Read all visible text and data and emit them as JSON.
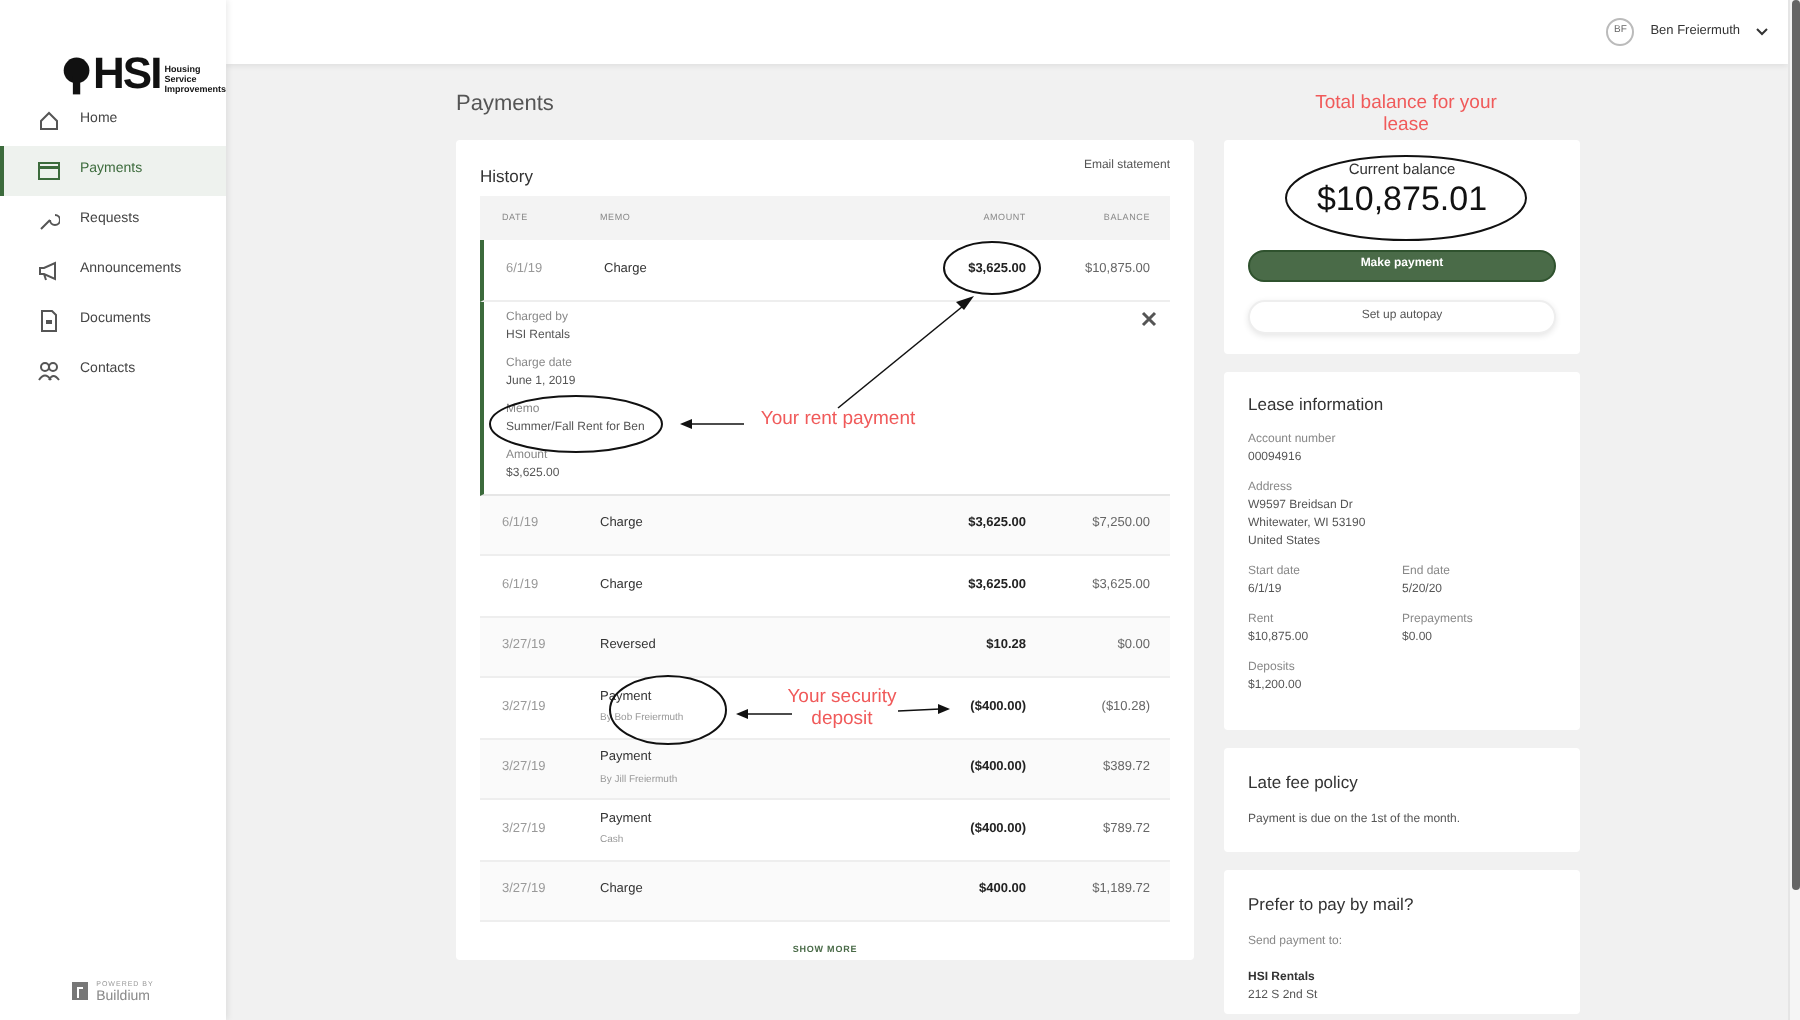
{
  "logo": {
    "text": "HSI",
    "tagline": [
      "Housing",
      "Service",
      "Improvements"
    ]
  },
  "sidebar": {
    "items": [
      {
        "label": "Home",
        "selected": false
      },
      {
        "label": "Payments",
        "selected": true
      },
      {
        "label": "Requests",
        "selected": false
      },
      {
        "label": "Announcements",
        "selected": false
      },
      {
        "label": "Documents",
        "selected": false
      },
      {
        "label": "Contacts",
        "selected": false
      }
    ],
    "footer": {
      "caption": "POWERED BY",
      "brand": "Buildium"
    }
  },
  "header": {
    "user_initials": "BF",
    "user_name": "Ben Freiermuth"
  },
  "page_title": "Payments",
  "history": {
    "title": "History",
    "email_link": "Email statement",
    "columns": [
      "DATE",
      "MEMO",
      "AMOUNT",
      "BALANCE"
    ],
    "rows": [
      {
        "date": "6/1/19",
        "memo": "Charge",
        "amount": "$3,625.00",
        "balance": "$10,875.00",
        "expanded": true,
        "details": [
          {
            "label": "Charged by",
            "value": "HSI Rentals"
          },
          {
            "label": "Charge date",
            "value": "June 1, 2019"
          },
          {
            "label": "Memo",
            "value": "Summer/Fall Rent for Ben"
          },
          {
            "label": "Amount",
            "value": "$3,625.00"
          }
        ]
      },
      {
        "date": "6/1/19",
        "memo": "Charge",
        "amount": "$3,625.00",
        "balance": "$7,250.00",
        "expanded": false
      },
      {
        "date": "6/1/19",
        "memo": "Charge",
        "amount": "$3,625.00",
        "balance": "$3,625.00",
        "expanded": false
      },
      {
        "date": "3/27/19",
        "memo": "Reversed",
        "amount": "$10.28",
        "balance": "$0.00",
        "expanded": false
      },
      {
        "date": "3/27/19",
        "memo": "Payment",
        "sub": "By Bob Freiermuth",
        "amount": "($400.00)",
        "balance": "($10.28)",
        "expanded": false
      },
      {
        "date": "3/27/19",
        "memo": "Payment",
        "sub": "By Jill Freiermuth",
        "amount": "($400.00)",
        "balance": "$389.72",
        "expanded": false
      },
      {
        "date": "3/27/19",
        "memo": "Payment",
        "sub": "Cash",
        "amount": "($400.00)",
        "balance": "$789.72",
        "expanded": false
      },
      {
        "date": "3/27/19",
        "memo": "Charge",
        "amount": "$400.00",
        "balance": "$1,189.72",
        "expanded": false
      }
    ],
    "show_more": "SHOW MORE"
  },
  "balance": {
    "label": "Current balance",
    "amount": "$10,875.01",
    "primary_button": "Make payment",
    "secondary_button": "Set up autopay"
  },
  "lease": {
    "title": "Lease information",
    "fields": [
      {
        "kind": "full",
        "label": "Account number",
        "lines": [
          "00094916"
        ]
      },
      {
        "kind": "full",
        "label": "Address",
        "lines": [
          "W9597 Breidsan Dr",
          "Whitewater, WI 53190",
          "United States"
        ]
      },
      {
        "kind": "half",
        "label": "Start date",
        "lines": [
          "6/1/19"
        ]
      },
      {
        "kind": "half",
        "label": "End date",
        "lines": [
          "5/20/20"
        ]
      },
      {
        "kind": "half",
        "label": "Rent",
        "lines": [
          "$10,875.00"
        ]
      },
      {
        "kind": "half",
        "label": "Prepayments",
        "lines": [
          "$0.00"
        ]
      },
      {
        "kind": "full",
        "label": "Deposits",
        "lines": [
          "$1,200.00"
        ]
      }
    ]
  },
  "late_fee": {
    "title": "Late fee policy",
    "text": "Payment is due on the 1st of the month."
  },
  "mail": {
    "title": "Prefer to pay by mail?",
    "text": "Send payment to:",
    "name": "HSI Rentals",
    "address": "212 S 2nd St"
  },
  "annotations": [
    {
      "kind": "balance",
      "text": "Total balance for your lease"
    },
    {
      "kind": "rent",
      "text": "Your rent payment"
    },
    {
      "kind": "deposit",
      "text": "Your security deposit"
    }
  ]
}
